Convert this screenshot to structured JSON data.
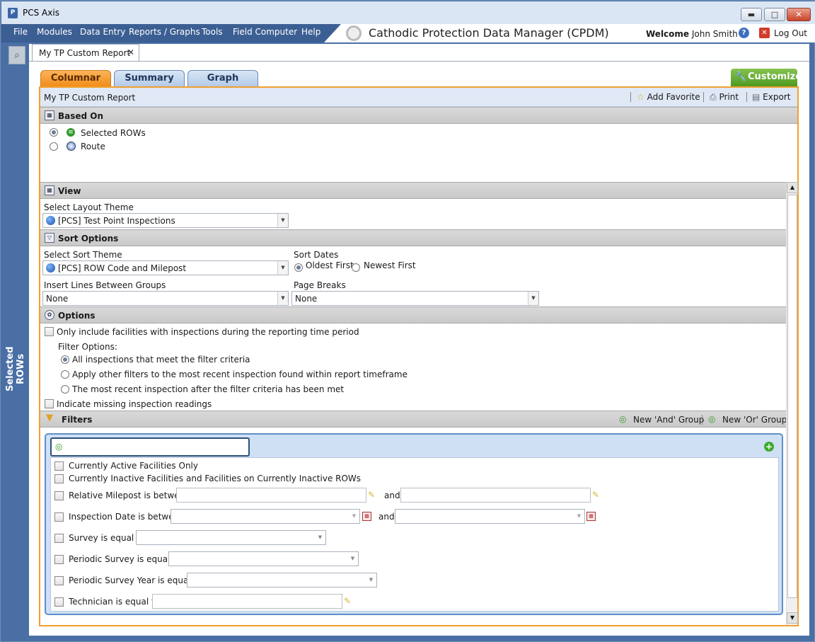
{
  "window": {
    "title": "PCS Axis",
    "minimize": "▬",
    "maximize": "□",
    "close": "✕"
  },
  "menu": {
    "items": [
      "File",
      "Modules",
      "Data Entry",
      "Reports / Graphs",
      "Tools",
      "Field Computer",
      "Help"
    ],
    "app_name": "Cathodic Protection Data Manager (CPDM)",
    "welcome_label": "Welcome",
    "user_name": "John Smith",
    "logout_label": "Log Out"
  },
  "sidebar": {
    "label": "Selected ROWs"
  },
  "doc_tab": {
    "label": "My TP Custom Report"
  },
  "view_tabs": [
    "Columnar",
    "Summary",
    "Graph"
  ],
  "active_tab": "Columnar",
  "customize_label": "Customize",
  "panel": {
    "title": "My TP Custom Report",
    "add_favorite": "Add Favorite",
    "print": "Print",
    "export": "Export"
  },
  "based_on": {
    "header": "Based On",
    "options": [
      "Selected ROWs",
      "Route"
    ],
    "selected": "Selected ROWs"
  },
  "view": {
    "header": "View",
    "layout_theme_label": "Select Layout Theme",
    "layout_theme_value": "[PCS] Test Point Inspections"
  },
  "sort_options": {
    "header": "Sort Options",
    "sort_theme_label": "Select Sort Theme",
    "sort_theme_value": "[PCS] ROW Code and Milepost",
    "sort_dates_label": "Sort Dates",
    "oldest_first": "Oldest First",
    "newest_first": "Newest First",
    "selected_sort_date": "Oldest First",
    "insert_lines_label": "Insert Lines Between Groups",
    "insert_lines_value": "None",
    "page_breaks_label": "Page Breaks",
    "page_breaks_value": "None"
  },
  "options": {
    "header": "Options",
    "only_include": "Only include facilities with inspections during the reporting time period",
    "filter_options_label": "Filter Options:",
    "filter_choices": [
      "All inspections that meet the filter criteria",
      "Apply other filters to the most recent inspection found within report timeframe",
      "The most recent inspection after the filter criteria has been met"
    ],
    "selected_filter_choice": "All inspections that meet the filter criteria",
    "indicate_missing": "Indicate missing inspection readings"
  },
  "filters": {
    "header": "Filters",
    "new_and_group": "New 'And' Group",
    "new_or_group": "New 'Or' Group",
    "rows": [
      "Currently Active Facilities Only",
      "Currently Inactive Facilities and Facilities on Currently Inactive ROWs",
      "Relative Milepost is between",
      "Inspection Date is between",
      "Survey is equal to",
      "Periodic Survey is equal to",
      "Periodic Survey Year is equal to",
      "Technician is equal to"
    ],
    "and_label": "and"
  }
}
